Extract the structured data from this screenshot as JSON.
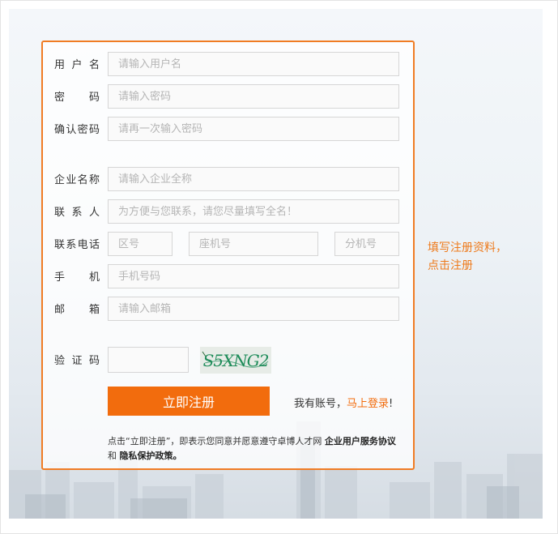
{
  "form": {
    "username_label": "用户名",
    "username_placeholder": "请输入用户名",
    "password_label": "密码",
    "password_placeholder": "请输入密码",
    "confirm_label": "确认密码",
    "confirm_placeholder": "请再一次输入密码",
    "company_label": "企业名称",
    "company_placeholder": "请输入企业全称",
    "contact_label": "联系人",
    "contact_placeholder": "为方便与您联系，请您尽量填写全名！",
    "phone_label": "联系电话",
    "area_placeholder": "区号",
    "landline_placeholder": "座机号",
    "extension_placeholder": "分机号",
    "mobile_label": "手机",
    "mobile_placeholder": "手机号码",
    "email_label": "邮箱",
    "email_placeholder": "请输入邮箱",
    "captcha_label": "验证码",
    "captcha_text": "S5XNG2",
    "submit_label": "立即注册",
    "login_prefix": "我有账号，",
    "login_link": "马上登录",
    "login_suffix": "!",
    "agreement_prefix": "点击“立即注册”，即表示您同意并愿意遵守卓博人才网 ",
    "agreement_service": "企业用户服务协议",
    "agreement_and": " 和 ",
    "agreement_privacy": "隐私保护政策。"
  },
  "side_hint": {
    "line1": "填写注册资料，",
    "line2": "点击注册"
  },
  "colors": {
    "accent": "#f26c0d",
    "border": "#f07c24",
    "hint": "#ee7a1b"
  }
}
